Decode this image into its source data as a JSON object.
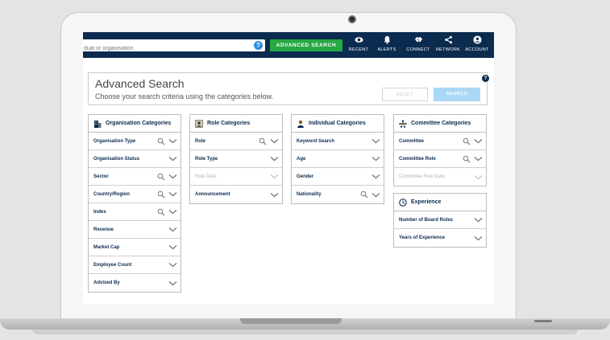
{
  "navbar": {
    "search_placeholder": "dual or organisation",
    "help_label": "?",
    "advanced_search_label": "ADVANCED SEARCH",
    "items": [
      {
        "label": "RECENT",
        "icon": "eye-icon"
      },
      {
        "label": "ALERTS",
        "icon": "bell-icon"
      },
      {
        "label": "CONNECT",
        "icon": "handshake-icon"
      },
      {
        "label": "NETWORK",
        "icon": "share-icon"
      },
      {
        "label": "ACCOUNT",
        "icon": "user-icon"
      }
    ]
  },
  "heading": {
    "title": "Advanced Search",
    "subtitle": "Choose your search criteria using the categories below.",
    "reset_label": "RESET",
    "search_label": "SEARCH",
    "help_label": "?"
  },
  "panels": {
    "organisation": {
      "title": "Organisation Categories",
      "rows": [
        {
          "label": "Organisation Type",
          "search": true
        },
        {
          "label": "Organisation Status",
          "search": false
        },
        {
          "label": "Sector",
          "search": true
        },
        {
          "label": "Country/Region",
          "search": true
        },
        {
          "label": "Index",
          "search": true
        },
        {
          "label": "Revenue",
          "search": false
        },
        {
          "label": "Market Cap",
          "search": false
        },
        {
          "label": "Employee Count",
          "search": false
        },
        {
          "label": "Advised By",
          "search": false
        }
      ]
    },
    "role": {
      "title": "Role Categories",
      "rows": [
        {
          "label": "Role",
          "search": true
        },
        {
          "label": "Role Type",
          "search": false
        },
        {
          "label": "Role Date",
          "search": false,
          "disabled": true
        },
        {
          "label": "Announcement",
          "search": false
        }
      ]
    },
    "individual": {
      "title": "Individual Categories",
      "rows": [
        {
          "label": "Keyword Search",
          "search": false
        },
        {
          "label": "Age",
          "search": false
        },
        {
          "label": "Gender",
          "search": false
        },
        {
          "label": "Nationality",
          "search": true
        }
      ]
    },
    "committee": {
      "title": "Committee Categories",
      "rows": [
        {
          "label": "Committee",
          "search": true
        },
        {
          "label": "Committee Role",
          "search": true
        },
        {
          "label": "Committee Role Date",
          "search": false,
          "disabled": true
        }
      ]
    },
    "experience": {
      "title": "Experience",
      "rows": [
        {
          "label": "Number of Board Roles",
          "search": false
        },
        {
          "label": "Years of Experience",
          "search": false
        }
      ]
    }
  },
  "colors": {
    "navy": "#0b2b4f",
    "green": "#27a844",
    "light_blue": "#a9d8f7",
    "help_blue": "#2b8fe0"
  }
}
